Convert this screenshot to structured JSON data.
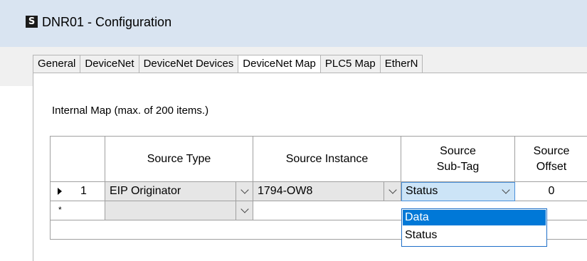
{
  "window": {
    "app_icon_glyph": "S",
    "title": "DNR01 - Configuration"
  },
  "tabs": [
    {
      "label": "General"
    },
    {
      "label": "DeviceNet"
    },
    {
      "label": "DeviceNet Devices"
    },
    {
      "label": "DeviceNet Map"
    },
    {
      "label": "PLC5 Map"
    },
    {
      "label": "EtherN"
    }
  ],
  "internal_map_label": "Internal Map (max. of 200 items.)",
  "grid": {
    "headers": {
      "source_type": "Source Type",
      "source_instance": "Source Instance",
      "source_subtag": "Source\nSub-Tag",
      "source_offset": "Source\nOffset"
    },
    "rows": [
      {
        "index": "1",
        "source_type": "EIP Originator",
        "source_instance": "1794-OW8",
        "source_subtag": "Status",
        "source_offset": "0"
      },
      {
        "index": "*",
        "source_type": "",
        "source_instance": "",
        "source_subtag": "",
        "source_offset": ""
      }
    ]
  },
  "subtag_dropdown": {
    "options": [
      "Data",
      "Status"
    ],
    "highlighted": "Data"
  },
  "colors": {
    "titlebar": "#d9e4f1",
    "highlight": "#0078d7",
    "selected_cell": "#cce4f7"
  }
}
